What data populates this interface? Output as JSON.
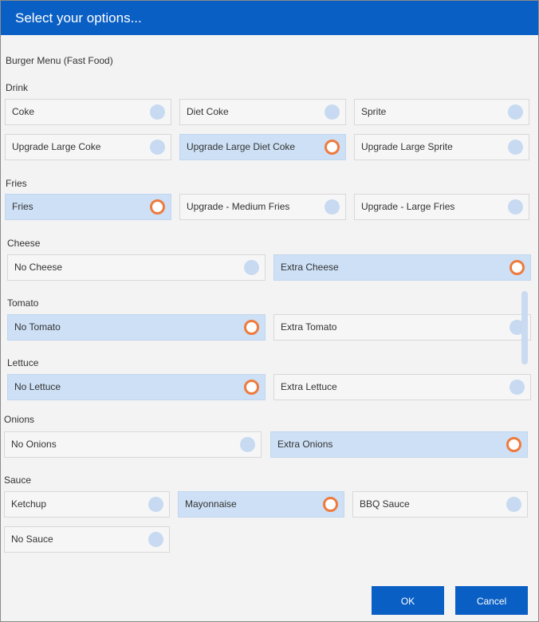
{
  "dialog": {
    "title": "Select your options..."
  },
  "menu": {
    "title": "Burger Menu (Fast Food)"
  },
  "colors": {
    "accent": "#0a5fc4",
    "selected_bg": "#cde0f5",
    "radio_selected": "#ee7b3d",
    "radio_idle": "#c7daf1"
  },
  "groups": {
    "drink": {
      "label": "Drink",
      "options": [
        {
          "label": "Coke",
          "selected": false
        },
        {
          "label": "Diet Coke",
          "selected": false
        },
        {
          "label": "Sprite",
          "selected": false
        },
        {
          "label": "Upgrade Large Coke",
          "selected": false
        },
        {
          "label": "Upgrade Large Diet Coke",
          "selected": true
        },
        {
          "label": "Upgrade Large Sprite",
          "selected": false
        }
      ]
    },
    "fries": {
      "label": "Fries",
      "options": [
        {
          "label": "Fries",
          "selected": true
        },
        {
          "label": "Upgrade - Medium Fries",
          "selected": false
        },
        {
          "label": "Upgrade - Large Fries",
          "selected": false
        }
      ]
    },
    "cheese": {
      "label": "Cheese",
      "options": [
        {
          "label": "No Cheese",
          "selected": false
        },
        {
          "label": "Extra Cheese",
          "selected": true
        }
      ]
    },
    "tomato": {
      "label": "Tomato",
      "options": [
        {
          "label": "No Tomato",
          "selected": true
        },
        {
          "label": "Extra Tomato",
          "selected": false
        }
      ]
    },
    "lettuce": {
      "label": "Lettuce",
      "options": [
        {
          "label": "No Lettuce",
          "selected": true
        },
        {
          "label": "Extra Lettuce",
          "selected": false
        }
      ]
    },
    "onions": {
      "label": "Onions",
      "options": [
        {
          "label": "No Onions",
          "selected": false
        },
        {
          "label": "Extra Onions",
          "selected": true
        }
      ]
    },
    "sauce": {
      "label": "Sauce",
      "options": [
        {
          "label": "Ketchup",
          "selected": false
        },
        {
          "label": "Mayonnaise",
          "selected": true
        },
        {
          "label": "BBQ Sauce",
          "selected": false
        },
        {
          "label": "No Sauce",
          "selected": false
        }
      ]
    }
  },
  "buttons": {
    "ok": "OK",
    "cancel": "Cancel"
  }
}
